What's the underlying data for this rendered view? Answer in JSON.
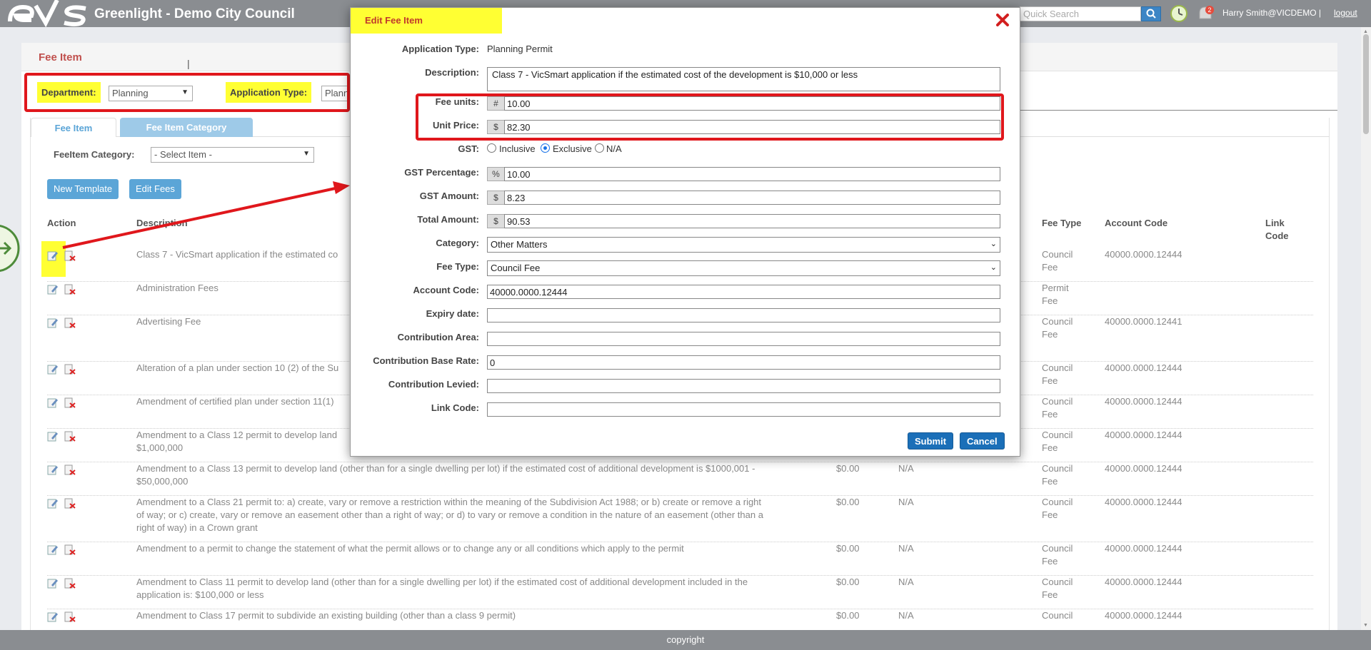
{
  "app": {
    "title": "Greenlight - Demo City Council",
    "search_placeholder": "Quick Search",
    "user": "Harry Smith@VICDEMO",
    "separator": "|",
    "logout": "logout",
    "notification_count": "2",
    "footer": "copyright"
  },
  "page": {
    "title": "Fee Item",
    "department_label": "Department:",
    "department_value": "Planning",
    "pipe": "|",
    "app_type_label": "Application Type:",
    "app_type_value": "Plann",
    "tabs": [
      "Fee Item",
      "Fee Item Category"
    ],
    "category_label": "FeeItem Category:",
    "category_value": "- Select Item -",
    "buttons": {
      "new_template": "New Template",
      "edit_fees": "Edit Fees"
    }
  },
  "grid": {
    "headers": {
      "action": "Action",
      "description": "Description",
      "fee_type": "Fee Type",
      "account_code": "Account Code",
      "link_code": "Link Code"
    },
    "rows": [
      {
        "description": "Class 7 - VicSmart application if the estimated co",
        "price": "",
        "gst": "",
        "fee_type": "Council Fee",
        "account": "40000.0000.12444"
      },
      {
        "description": "Administration Fees",
        "price": "",
        "gst": "",
        "fee_type": "Permit Fee",
        "account": ""
      },
      {
        "description": "Advertising Fee",
        "price": "",
        "gst": "",
        "fee_type": "Council Fee",
        "account": "40000.0000.12441"
      },
      {
        "description": "Alteration of a plan under section 10 (2) of the Su",
        "price": "",
        "gst": "",
        "fee_type": "Council Fee",
        "account": "40000.0000.12444"
      },
      {
        "description": "Amendment of certified plan under section 11(1)",
        "price": "",
        "gst": "",
        "fee_type": "Council Fee",
        "account": "40000.0000.12444"
      },
      {
        "description": "Amendment to a Class 12 permit to develop land",
        "description2": "$1,000,000",
        "price": "",
        "gst": "",
        "fee_type": "Council Fee",
        "account": "40000.0000.12444"
      },
      {
        "description": "Amendment to a Class 13 permit to develop land (other than for a single dwelling per lot) if the estimated cost of additional development is $1000,001 -",
        "description2": "$50,000,000",
        "price": "$0.00",
        "gst": "N/A",
        "fee_type": "Council Fee",
        "account": "40000.0000.12444"
      },
      {
        "description": "Amendment to a Class 21 permit to: a) create, vary or remove a restriction within the meaning of the Subdivision Act 1988; or b) create or remove a right",
        "description2": "of way; or c) create, vary or remove an easement other than a right of way; or d) to vary or remove a condition in the nature of an easement (other than a",
        "description3": "right of way) in a Crown grant",
        "price": "$0.00",
        "gst": "N/A",
        "fee_type": "Council Fee",
        "account": "40000.0000.12444"
      },
      {
        "description": "Amendment to a permit to change the statement of what the permit allows or to change any or all conditions which apply to the permit",
        "price": "$0.00",
        "gst": "N/A",
        "fee_type": "Council Fee",
        "account": "40000.0000.12444"
      },
      {
        "description": "Amendment to Class 11 permit to develop land (other than for a single dwelling per lot) if the estimated cost of additional development included in the",
        "description2": "application is: $100,000 or less",
        "price": "$0.00",
        "gst": "N/A",
        "fee_type": "Council Fee",
        "account": "40000.0000.12444"
      },
      {
        "description": "Amendment to Class 17 permit to subdivide an existing building (other than a class 9 permit)",
        "price": "$0.00",
        "gst": "N/A",
        "fee_type": "Council",
        "account": "40000.0000.12444"
      }
    ]
  },
  "modal": {
    "title": "Edit Fee Item",
    "labels": {
      "app_type": "Application Type:",
      "description": "Description:",
      "fee_units": "Fee units:",
      "unit_price": "Unit Price:",
      "gst": "GST:",
      "gst_percentage": "GST Percentage:",
      "gst_amount": "GST Amount:",
      "total_amount": "Total Amount:",
      "category": "Category:",
      "fee_type": "Fee Type:",
      "account_code": "Account Code:",
      "expiry_date": "Expiry date:",
      "contribution_area": "Contribution Area:",
      "contribution_base_rate": "Contribution Base Rate:",
      "contribution_levied": "Contribution Levied:",
      "link_code": "Link Code:"
    },
    "values": {
      "app_type": "Planning Permit",
      "description": "Class 7 - VicSmart application if the estimated cost of the development is $10,000 or less",
      "fee_units": "10.00",
      "unit_price": "82.30",
      "gst_options": [
        "Inclusive",
        "Exclusive",
        "N/A"
      ],
      "gst_selected": "Exclusive",
      "gst_percentage": "10.00",
      "gst_amount": "8.23",
      "total_amount": "90.53",
      "category": "Other Matters",
      "fee_type": "Council Fee",
      "account_code": "40000.0000.12444",
      "expiry_date": "",
      "contribution_area": "",
      "contribution_base_rate": "0",
      "contribution_levied": "",
      "link_code": ""
    },
    "prefixes": {
      "units": "#",
      "currency": "$",
      "percent": "%"
    },
    "buttons": {
      "submit": "Submit",
      "cancel": "Cancel"
    }
  },
  "colors": {
    "annotation_red": "#e0171c",
    "highlight_yellow": "#ffff33",
    "accent_blue": "#1b6fb8",
    "topbar_gray": "#8a8d91"
  }
}
